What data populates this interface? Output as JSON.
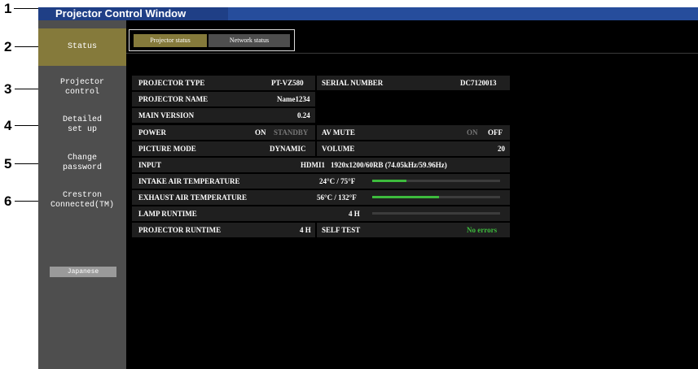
{
  "callouts": [
    "1",
    "2",
    "3",
    "4",
    "5",
    "6"
  ],
  "window": {
    "title": "Projector Control Window"
  },
  "sidebar": {
    "items": [
      {
        "label": "Status"
      },
      {
        "label": "Projector\ncontrol"
      },
      {
        "label": "Detailed\nset up"
      },
      {
        "label": "Change\npassword"
      },
      {
        "label": "Crestron\nConnected(TM)"
      }
    ],
    "language_button": "Japanese"
  },
  "tabs": [
    {
      "label": "Projector status",
      "active": true
    },
    {
      "label": "Network status",
      "active": false
    }
  ],
  "status": {
    "projector_type": {
      "label": "PROJECTOR TYPE",
      "value": "PT-VZ580"
    },
    "serial_number": {
      "label": "SERIAL NUMBER",
      "value": "DC7120013"
    },
    "projector_name": {
      "label": "PROJECTOR NAME",
      "value": "Name1234"
    },
    "main_version": {
      "label": "MAIN VERSION",
      "value": "0.24"
    },
    "power": {
      "label": "POWER",
      "on": "ON",
      "standby": "STANDBY",
      "state": "ON"
    },
    "av_mute": {
      "label": "AV MUTE",
      "on": "ON",
      "off": "OFF",
      "state": "OFF"
    },
    "picture_mode": {
      "label": "PICTURE MODE",
      "value": "DYNAMIC"
    },
    "volume": {
      "label": "VOLUME",
      "value": "20"
    },
    "input": {
      "label": "INPUT",
      "source": "HDMI1",
      "signal": "1920x1200/60RB (74.05kHz/59.96Hz)"
    },
    "intake_air": {
      "label": "INTAKE AIR TEMPERATURE",
      "value": "24°C / 75°F",
      "level": 0.27
    },
    "exhaust_air": {
      "label": "EXHAUST AIR TEMPERATURE",
      "value": "56°C / 132°F",
      "level": 0.52
    },
    "lamp_runtime": {
      "label": "LAMP RUNTIME",
      "value": "4 H",
      "level": 0.0
    },
    "projector_runtime": {
      "label": "PROJECTOR RUNTIME",
      "value": "4 H"
    },
    "self_test": {
      "label": "SELF TEST",
      "value": "No errors"
    }
  },
  "colors": {
    "title_bar": "#264d9c",
    "active_gold": "#857a3b",
    "sidebar_gray": "#4e4e4e",
    "status_green": "#3dbb3d"
  }
}
